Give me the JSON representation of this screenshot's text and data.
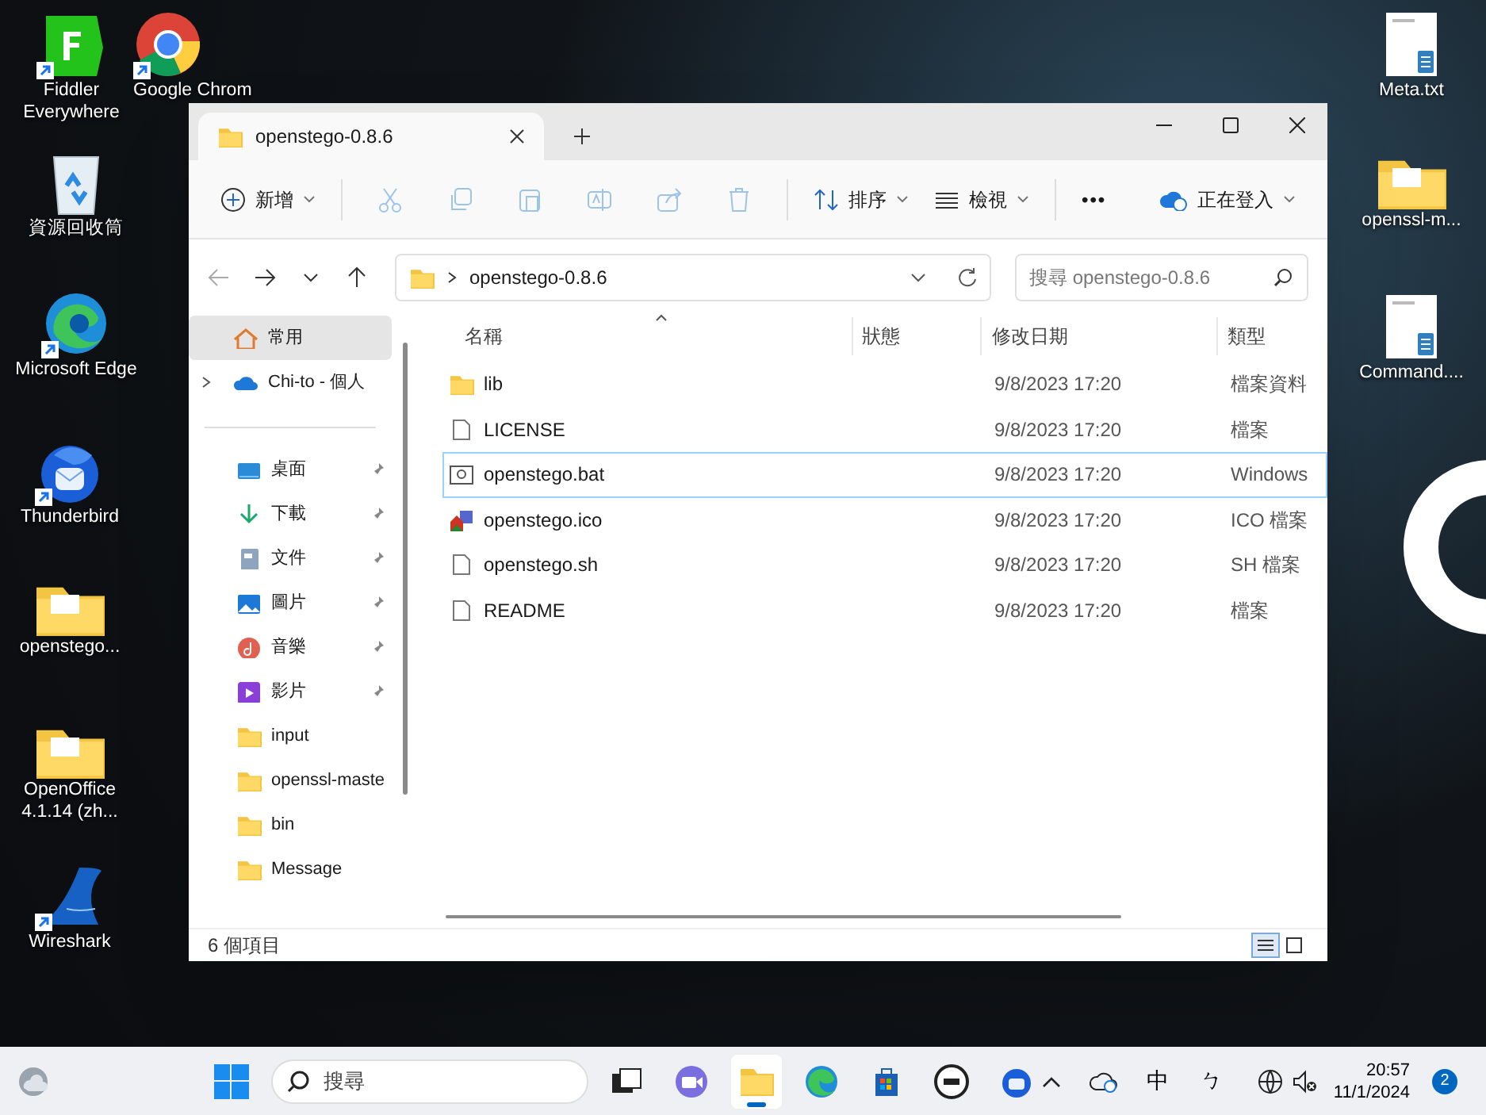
{
  "desktop_icons": [
    {
      "label": "Fiddler Everywhere",
      "kind": "fiddler",
      "shortcut": true
    },
    {
      "label": "Google Chrom",
      "kind": "chrome",
      "shortcut": true
    },
    {
      "label": "資源回收筒",
      "kind": "recycle",
      "shortcut": false
    },
    {
      "label": "Microsoft Edge",
      "kind": "edge",
      "shortcut": true
    },
    {
      "label": "Thunderbird",
      "kind": "thunderbird",
      "shortcut": true
    },
    {
      "label": "openstego...",
      "kind": "folder",
      "shortcut": false
    },
    {
      "label": "OpenOffice 4.1.14 (zh...",
      "kind": "folder",
      "shortcut": false
    },
    {
      "label": "Wireshark",
      "kind": "wireshark",
      "shortcut": true
    },
    {
      "label": "Meta.txt",
      "kind": "textfile",
      "shortcut": false
    },
    {
      "label": "openssl-m...",
      "kind": "folder",
      "shortcut": false
    },
    {
      "label": "Command....",
      "kind": "textfile",
      "shortcut": false
    }
  ],
  "window": {
    "tab_title": "openstego-0.8.6",
    "toolbar": [
      {
        "kind": "new",
        "label": "新增",
        "disabled": false
      },
      {
        "kind": "cut",
        "disabled": true
      },
      {
        "kind": "copy",
        "disabled": true
      },
      {
        "kind": "paste",
        "disabled": true
      },
      {
        "kind": "rename",
        "disabled": true
      },
      {
        "kind": "share",
        "disabled": true
      },
      {
        "kind": "delete",
        "disabled": true
      },
      {
        "kind": "sort",
        "label": "排序",
        "disabled": false
      },
      {
        "kind": "view",
        "label": "檢視",
        "disabled": false
      },
      {
        "kind": "more",
        "label": "•••",
        "disabled": false
      }
    ],
    "signin": "正在登入",
    "address": "openstego-0.8.6",
    "search_placeholder": "搜尋 openstego-0.8.6",
    "sidebar": [
      {
        "label": "常用",
        "kind": "home",
        "selected": true
      },
      {
        "label": "Chi-to - 個人",
        "kind": "cloud",
        "selected": false
      },
      {
        "label": "桌面",
        "kind": "desktop",
        "pinned": true,
        "selected": false
      },
      {
        "label": "下載",
        "kind": "download",
        "pinned": true,
        "selected": false
      },
      {
        "label": "文件",
        "kind": "documents",
        "pinned": true,
        "selected": false
      },
      {
        "label": "圖片",
        "kind": "pictures",
        "pinned": true,
        "selected": false
      },
      {
        "label": "音樂",
        "kind": "music",
        "pinned": true,
        "selected": false
      },
      {
        "label": "影片",
        "kind": "videos",
        "pinned": true,
        "selected": false
      },
      {
        "label": "input",
        "kind": "folder",
        "pinned": false,
        "selected": false
      },
      {
        "label": "openssl-maste",
        "kind": "folder",
        "pinned": false,
        "selected": false
      },
      {
        "label": "bin",
        "kind": "folder",
        "pinned": false,
        "selected": false
      },
      {
        "label": "Message",
        "kind": "folder",
        "pinned": false,
        "selected": false
      }
    ],
    "columns": [
      "名稱",
      "狀態",
      "修改日期",
      "類型"
    ],
    "files": [
      {
        "name": "lib",
        "kind": "folder",
        "modified": "9/8/2023 17:20",
        "type": "檔案資料",
        "focused": false
      },
      {
        "name": "LICENSE",
        "kind": "file",
        "modified": "9/8/2023 17:20",
        "type": "檔案",
        "focused": false
      },
      {
        "name": "openstego.bat",
        "kind": "bat",
        "modified": "9/8/2023 17:20",
        "type": "Windows",
        "focused": true
      },
      {
        "name": "openstego.ico",
        "kind": "ico",
        "modified": "9/8/2023 17:20",
        "type": "ICO 檔案",
        "focused": false
      },
      {
        "name": "openstego.sh",
        "kind": "file",
        "modified": "9/8/2023 17:20",
        "type": "SH 檔案",
        "focused": false
      },
      {
        "name": "README",
        "kind": "file",
        "modified": "9/8/2023 17:20",
        "type": "檔案",
        "focused": false
      }
    ],
    "status": "6 個項目"
  },
  "taskbar": {
    "search_placeholder": "搜尋",
    "apps": [
      {
        "kind": "taskview",
        "active": false
      },
      {
        "kind": "teams",
        "active": false
      },
      {
        "kind": "explorer",
        "active": true
      },
      {
        "kind": "edge",
        "active": false
      },
      {
        "kind": "store",
        "active": false
      },
      {
        "kind": "dell",
        "active": false
      },
      {
        "kind": "thunderbird",
        "active": false
      }
    ],
    "ime": "中",
    "ime_mode": "ㄅ",
    "time": "20:57",
    "date": "11/1/2024",
    "notifications": "2"
  }
}
